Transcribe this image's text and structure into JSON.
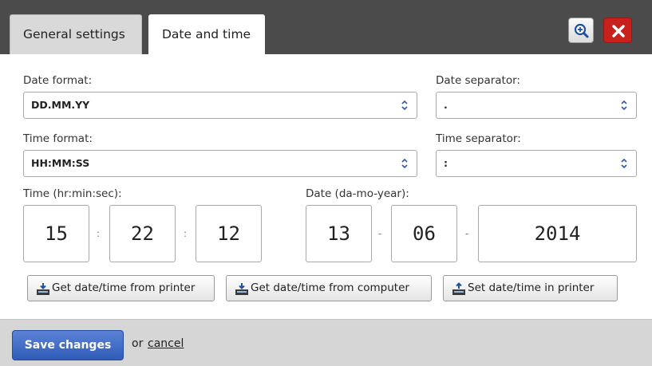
{
  "tabs": [
    {
      "label": "General settings",
      "active": false
    },
    {
      "label": "Date and time",
      "active": true
    }
  ],
  "header_icons": [
    "zoom-icon",
    "close-icon"
  ],
  "colors": {
    "close": "#c8201c",
    "save": "#3a66c4",
    "header": "#4b4b4b",
    "footer": "#d6d6d6"
  },
  "form": {
    "date_format": {
      "label": "Date format:",
      "value": "DD.MM.YY"
    },
    "date_separator": {
      "label": "Date separator:",
      "value": "."
    },
    "time_format": {
      "label": "Time format:",
      "value": "HH:MM:SS"
    },
    "time_separator": {
      "label": "Time separator:",
      "value": ":"
    },
    "time": {
      "label": "Time (hr:min:sec):",
      "hour": "15",
      "minute": "22",
      "second": "12",
      "sep": ":"
    },
    "date": {
      "label": "Date (da-mo-year):",
      "day": "13",
      "month": "06",
      "year": "2014",
      "sep": "-"
    }
  },
  "actions": {
    "get_from_printer": "Get date/time from printer",
    "get_from_computer": "Get date/time from computer",
    "set_in_printer": "Set date/time in printer"
  },
  "footer": {
    "save_label": "Save changes",
    "or_text": "or",
    "cancel_label": "cancel"
  }
}
